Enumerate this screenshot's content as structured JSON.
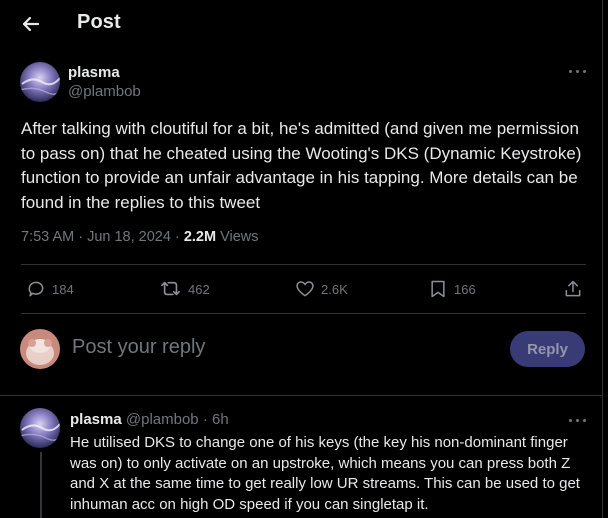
{
  "header": {
    "title": "Post"
  },
  "post": {
    "author_name": "plasma",
    "author_handle": "@plambob",
    "text": "After talking with cloutiful for a bit, he's admitted (and given me permission to pass on) that he cheated using the Wooting's DKS (Dynamic Keystroke) function to provide an unfair advantage in his tapping. More details can be found in the replies to this tweet",
    "timestamp": "7:53 AM · Jun 18, 2024 · ",
    "views_count": "2.2M",
    "views_label": " Views",
    "actions": {
      "replies": "184",
      "reposts": "462",
      "likes": "2.6K",
      "bookmarks": "166"
    }
  },
  "composer": {
    "placeholder": "Post your reply",
    "button_label": "Reply"
  },
  "reply": {
    "author_name": "plasma",
    "author_handle": "@plambob",
    "sep": "·",
    "age": "6h",
    "text": "He utilised DKS to change one of his keys (the key his non-dominant finger was on) to only activate on an upstroke, which means you can press both Z and X at the same time to get really low UR streams. This can be used to get inhuman acc on high OD speed if you can singletap it."
  },
  "colors": {
    "background": "#000000",
    "text": "#e7e9ea",
    "muted": "#71767b",
    "divider": "#2f3336",
    "reply_button": "#4b4f9e"
  },
  "icons": [
    "back-arrow-icon",
    "more-icon",
    "reply-icon",
    "repost-icon",
    "like-icon",
    "bookmark-icon",
    "share-icon"
  ]
}
